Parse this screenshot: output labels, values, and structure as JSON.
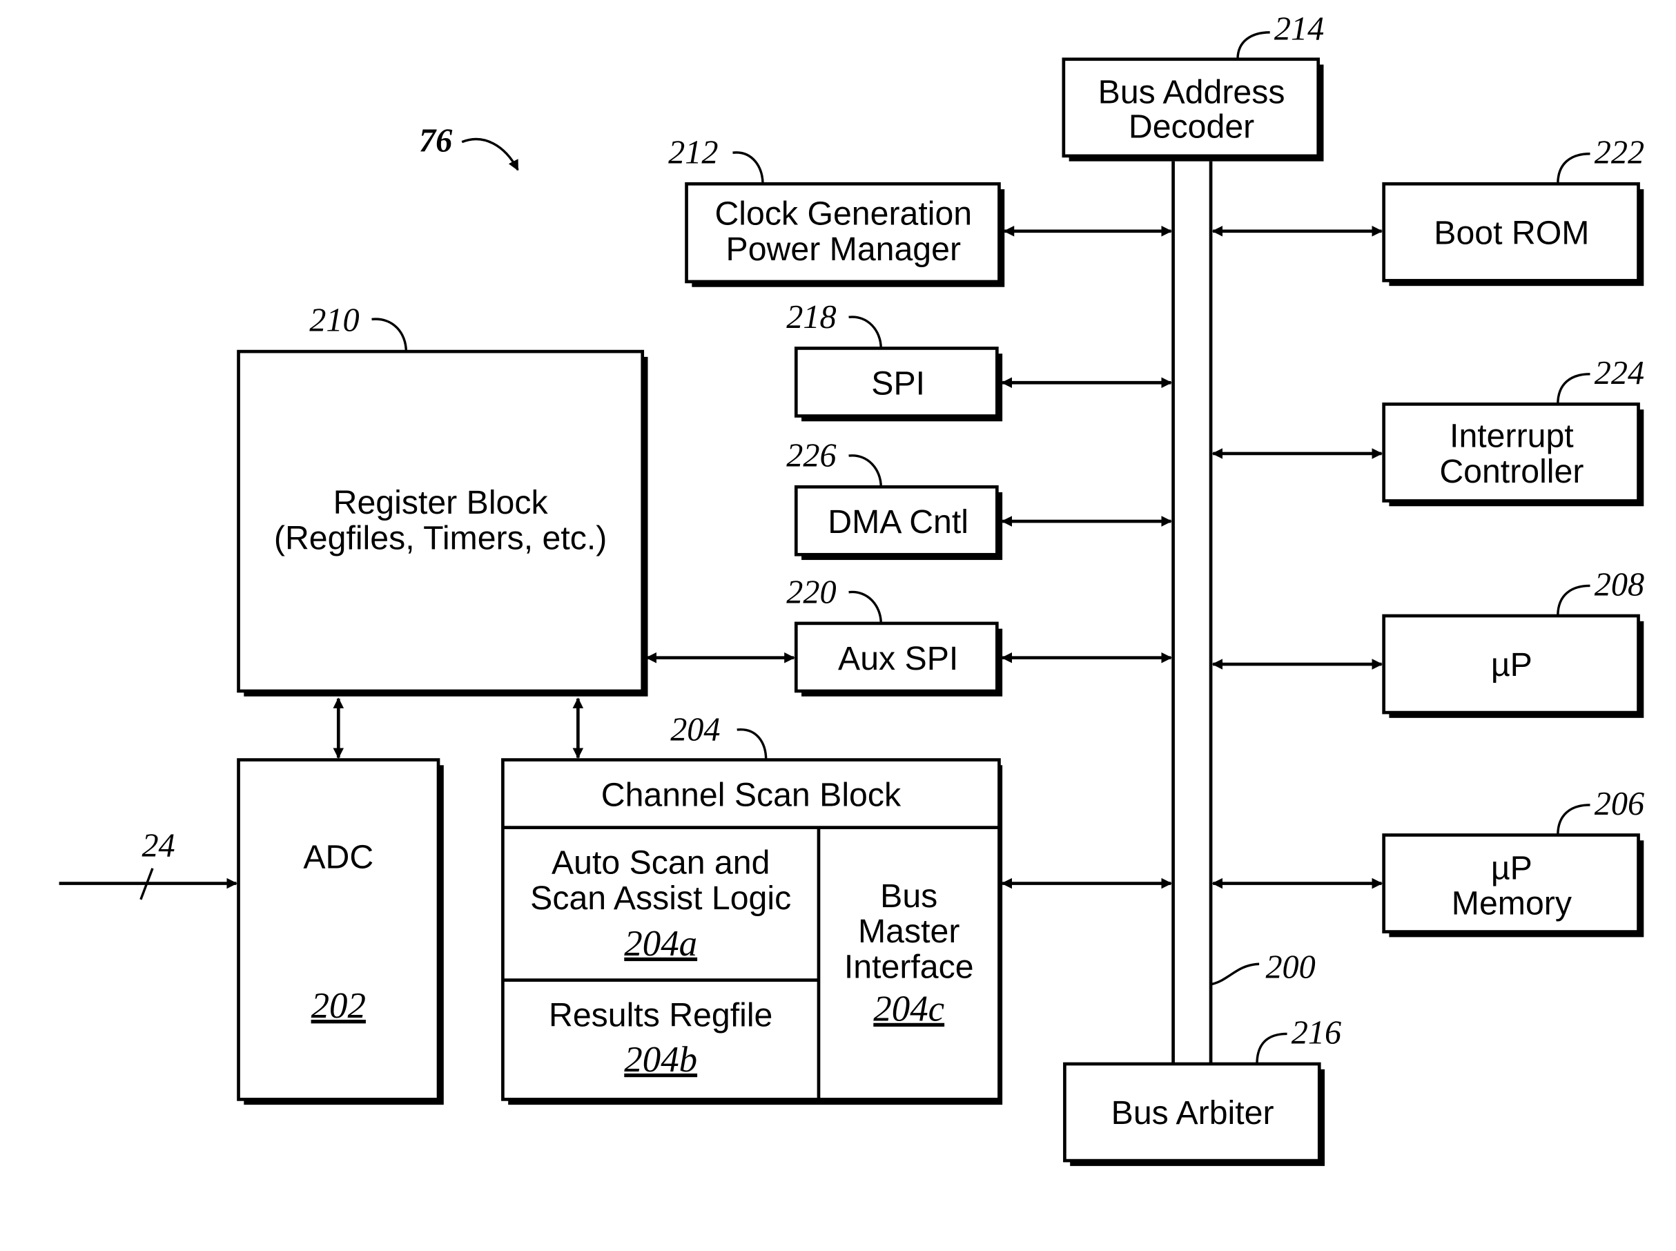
{
  "figure": {
    "reference": "76",
    "bus_reference": "200",
    "input_reference": "24"
  },
  "blocks": {
    "bus_address_decoder": {
      "lines": [
        "Bus Address",
        "Decoder"
      ],
      "ref": "214"
    },
    "clock_generation": {
      "lines": [
        "Clock Generation",
        "Power Manager"
      ],
      "ref": "212"
    },
    "spi": {
      "lines": [
        "SPI"
      ],
      "ref": "218"
    },
    "dma": {
      "lines": [
        "DMA Cntl"
      ],
      "ref": "226"
    },
    "aux_spi": {
      "lines": [
        "Aux SPI"
      ],
      "ref": "220"
    },
    "register_block": {
      "lines": [
        "Register Block",
        "(Regfiles, Timers, etc.)"
      ],
      "ref": "210"
    },
    "boot_rom": {
      "lines": [
        "Boot ROM"
      ],
      "ref": "222"
    },
    "interrupt_controller": {
      "lines": [
        "Interrupt",
        "Controller"
      ],
      "ref": "224"
    },
    "up": {
      "lines": [
        "µP"
      ],
      "ref": "208"
    },
    "up_memory": {
      "lines": [
        "µP",
        "Memory"
      ],
      "ref": "206"
    },
    "adc": {
      "lines": [
        "ADC"
      ],
      "ref": "202"
    },
    "channel_scan": {
      "title": "Channel Scan Block",
      "ref": "204",
      "auto_scan": {
        "lines": [
          "Auto Scan and",
          "Scan Assist Logic"
        ],
        "ref": "204a"
      },
      "results": {
        "lines": [
          "Results Regfile"
        ],
        "ref": "204b"
      },
      "bus_master": {
        "lines": [
          "Bus",
          "Master",
          "Interface"
        ],
        "ref": "204c"
      }
    },
    "bus_arbiter": {
      "lines": [
        "Bus Arbiter"
      ],
      "ref": "216"
    }
  }
}
